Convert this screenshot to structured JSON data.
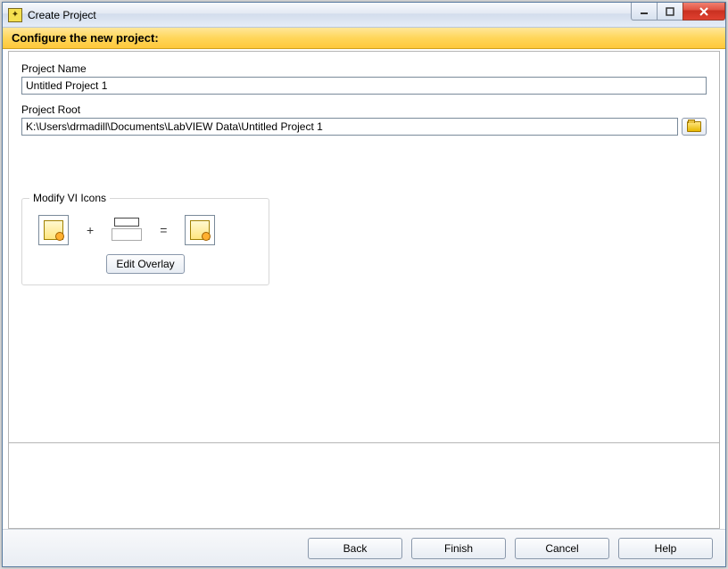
{
  "window": {
    "title": "Create Project"
  },
  "banner": {
    "text": "Configure the new project:"
  },
  "fields": {
    "project_name_label": "Project Name",
    "project_name_value": "Untitled Project 1",
    "project_root_label": "Project Root",
    "project_root_value": "K:\\Users\\drmadill\\Documents\\LabVIEW Data\\Untitled Project 1"
  },
  "icons_group": {
    "legend": "Modify VI Icons",
    "plus": "+",
    "equals": "=",
    "edit_overlay_label": "Edit Overlay"
  },
  "footer": {
    "back": "Back",
    "finish": "Finish",
    "cancel": "Cancel",
    "help": "Help"
  }
}
